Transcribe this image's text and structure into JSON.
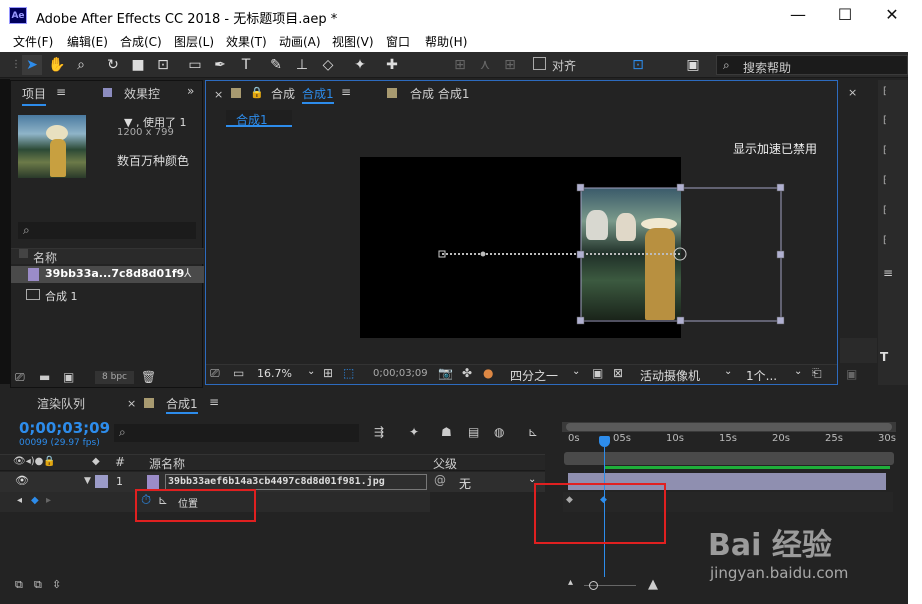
{
  "window": {
    "app_icon": "Ae",
    "title": "Adobe After Effects CC 2018 - 无标题项目.aep *"
  },
  "menu": [
    "文件(F)",
    "编辑(E)",
    "合成(C)",
    "图层(L)",
    "效果(T)",
    "动画(A)",
    "视图(V)",
    "窗口",
    "帮助(H)"
  ],
  "toolbar": {
    "snap_label": "对齐",
    "search_placeholder": "搜索帮助"
  },
  "project": {
    "tab_project": "项目",
    "tab_effects": "效果控",
    "item_meta": "▼ , 使用了 1",
    "item_size": "1200 x 799",
    "item_color": "数百万种颜色",
    "column_name": "名称",
    "items": [
      {
        "name": "39bb33a...7c8d8d01f9"
      },
      {
        "name": "合成 1"
      }
    ],
    "bpc": "8 bpc"
  },
  "viewer": {
    "tab_label": "合成",
    "tab_comp": "合成1",
    "tab2": "合成 合成1",
    "breadcrumb": "合成1",
    "accel_msg": "显示加速已禁用",
    "zoom": "16.7%",
    "timecode": "0;00;03;09",
    "resolution": "四分之一",
    "camera": "活动摄像机",
    "views": "1个..."
  },
  "timeline": {
    "tab_render": "渲染队列",
    "tab_comp": "合成1",
    "timecode": "0;00;03;09",
    "frame_info": "00099 (29.97 fps)",
    "col_num": "#",
    "col_source": "源名称",
    "col_parent": "父级",
    "layer_index": "1",
    "layer_name": "39bb33aef6b14a3cb4497c8d8d01f981.jpg",
    "parent_value": "无",
    "property": "位置",
    "ruler": [
      "0s",
      "05s",
      "10s",
      "15s",
      "20s",
      "25s",
      "30s"
    ],
    "playhead_fraction": 0.11
  },
  "watermark": {
    "text": "Bai  经验",
    "url": "jingyan.baidu.com"
  },
  "colors": {
    "accent": "#2d8ceb",
    "highlight_box": "#e02020",
    "layer_bar": "#8f8fb0",
    "green_bar": "#1fae3a"
  }
}
